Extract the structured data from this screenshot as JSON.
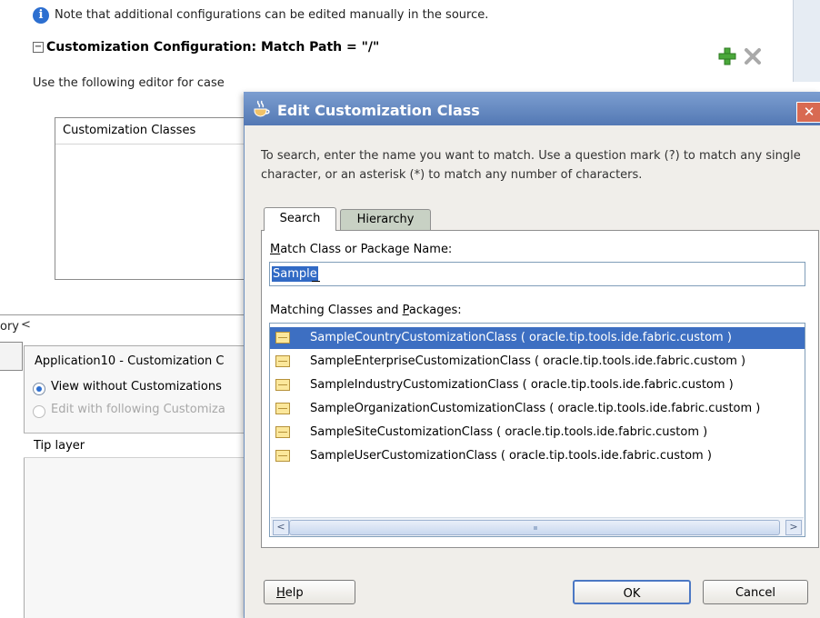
{
  "background": {
    "note": "Note that additional configurations can be edited manually in the source.",
    "section_title": "Customization Configuration: Match Path = \"/\"",
    "editor_hint": "Use the following editor for case",
    "classes_header": "Customization Classes",
    "left_tab_fragment": "ory",
    "app_title": "Application10 - Customization C",
    "radio_view": "View without Customizations",
    "radio_edit": "Edit with following Customiza",
    "tip_layer": "Tip layer",
    "icons": {
      "info": "info-icon",
      "add": "add-icon",
      "delete": "delete-icon"
    }
  },
  "dialog": {
    "title": "Edit Customization Class",
    "instructions": "To search, enter the name you want to match. Use a question mark (?) to match any single character, or an asterisk (*) to match any number of characters.",
    "tabs": [
      {
        "label": "Search",
        "active": true
      },
      {
        "label": "Hierarchy",
        "active": false
      }
    ],
    "match_label": "Match Class or Package Name:",
    "match_value": "Sample",
    "matching_label": "Matching Classes and Packages:",
    "results": [
      {
        "text": "SampleCountryCustomizationClass ( oracle.tip.tools.ide.fabric.custom )",
        "selected": true
      },
      {
        "text": "SampleEnterpriseCustomizationClass ( oracle.tip.tools.ide.fabric.custom )",
        "selected": false
      },
      {
        "text": "SampleIndustryCustomizationClass ( oracle.tip.tools.ide.fabric.custom )",
        "selected": false
      },
      {
        "text": "SampleOrganizationCustomizationClass ( oracle.tip.tools.ide.fabric.custom )",
        "selected": false
      },
      {
        "text": "SampleSiteCustomizationClass ( oracle.tip.tools.ide.fabric.custom )",
        "selected": false
      },
      {
        "text": "SampleUserCustomizationClass ( oracle.tip.tools.ide.fabric.custom )",
        "selected": false
      }
    ],
    "buttons": {
      "help": "Help",
      "ok": "OK",
      "cancel": "Cancel"
    },
    "colors": {
      "title_bar": "#5a7fbc",
      "selection": "#3d6fc2",
      "close": "#d86a52"
    }
  }
}
